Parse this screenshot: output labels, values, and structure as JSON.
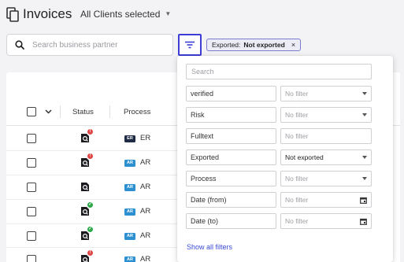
{
  "header": {
    "title": "Invoices",
    "client_select": "All Clients selected"
  },
  "search": {
    "placeholder": "Search business partner"
  },
  "active_filter_chip": {
    "key": "Exported:",
    "value": "Not exported",
    "remove": "×"
  },
  "table": {
    "columns": [
      "Status",
      "Process"
    ],
    "rows": [
      {
        "status_badge": "error",
        "process_tag": "ER",
        "process_label": "ER"
      },
      {
        "status_badge": "error",
        "process_tag": "AR",
        "process_label": "AR"
      },
      {
        "status_badge": "none",
        "process_tag": "AR",
        "process_label": "AR"
      },
      {
        "status_badge": "ok",
        "process_tag": "AR",
        "process_label": "AR"
      },
      {
        "status_badge": "ok",
        "process_tag": "AR",
        "process_label": "AR"
      },
      {
        "status_badge": "error",
        "process_tag": "AR",
        "process_label": "AR"
      }
    ]
  },
  "filter_panel": {
    "search_placeholder": "Search",
    "filters": [
      {
        "label": "verified",
        "value": "",
        "placeholder": "No filter",
        "control": "dropdown"
      },
      {
        "label": "Risk",
        "value": "",
        "placeholder": "No filter",
        "control": "dropdown"
      },
      {
        "label": "Fulltext",
        "value": "",
        "placeholder": "No filter",
        "control": "text"
      },
      {
        "label": "Exported",
        "value": "Not exported",
        "placeholder": "",
        "control": "dropdown"
      },
      {
        "label": "Process",
        "value": "",
        "placeholder": "No filter",
        "control": "dropdown"
      },
      {
        "label": "Date (from)",
        "value": "",
        "placeholder": "No filter",
        "control": "date"
      },
      {
        "label": "Date (to)",
        "value": "",
        "placeholder": "No filter",
        "control": "date"
      }
    ],
    "show_all": "Show all filters"
  },
  "colors": {
    "accent": "#3d3dd6",
    "link": "#3b4bd4",
    "error_badge": "#e04848",
    "ok_badge": "#2ea84a",
    "tag_er": "#1f2a44",
    "tag_ar": "#2b8fd0"
  },
  "icons": {
    "page": "document-copy-icon",
    "search": "search-icon",
    "filter": "filter-icon",
    "row_status": "document-search-icon",
    "row_menu": "chevron-down-icon",
    "calendar": "calendar-icon"
  }
}
